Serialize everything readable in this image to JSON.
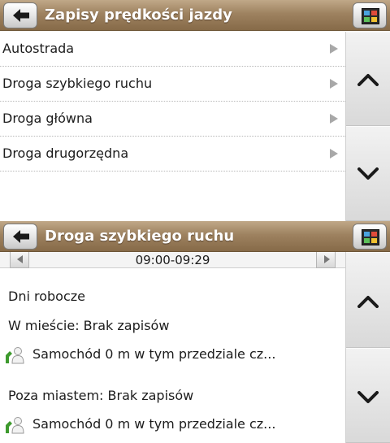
{
  "screen1": {
    "title": "Zapisy prędkości jazdy",
    "items": [
      {
        "label": "Autostrada"
      },
      {
        "label": "Droga szybkiego ruchu"
      },
      {
        "label": "Droga główna"
      },
      {
        "label": "Droga drugorzędna"
      }
    ]
  },
  "screen2": {
    "title": "Droga szybkiego ruchu",
    "time_range": "09:00-09:29",
    "day_type": "Dni robocze",
    "city_label": "W mieście: Brak zapisów",
    "city_detail": "Samochód 0 m w tym przedziale cz...",
    "outside_label": "Poza miastem: Brak zapisów",
    "outside_detail": "Samochód 0 m w tym przedziale cz..."
  },
  "colors": {
    "titlebar": "#9e8260",
    "title_text": "#ffffff",
    "scrollbar": "#e8e8e8",
    "icon_green": "#3e9a2e"
  },
  "icons": [
    "back-arrow-icon",
    "menu-icon",
    "chevron-right-icon",
    "chevron-up-icon",
    "chevron-down-icon",
    "person-icon"
  ]
}
